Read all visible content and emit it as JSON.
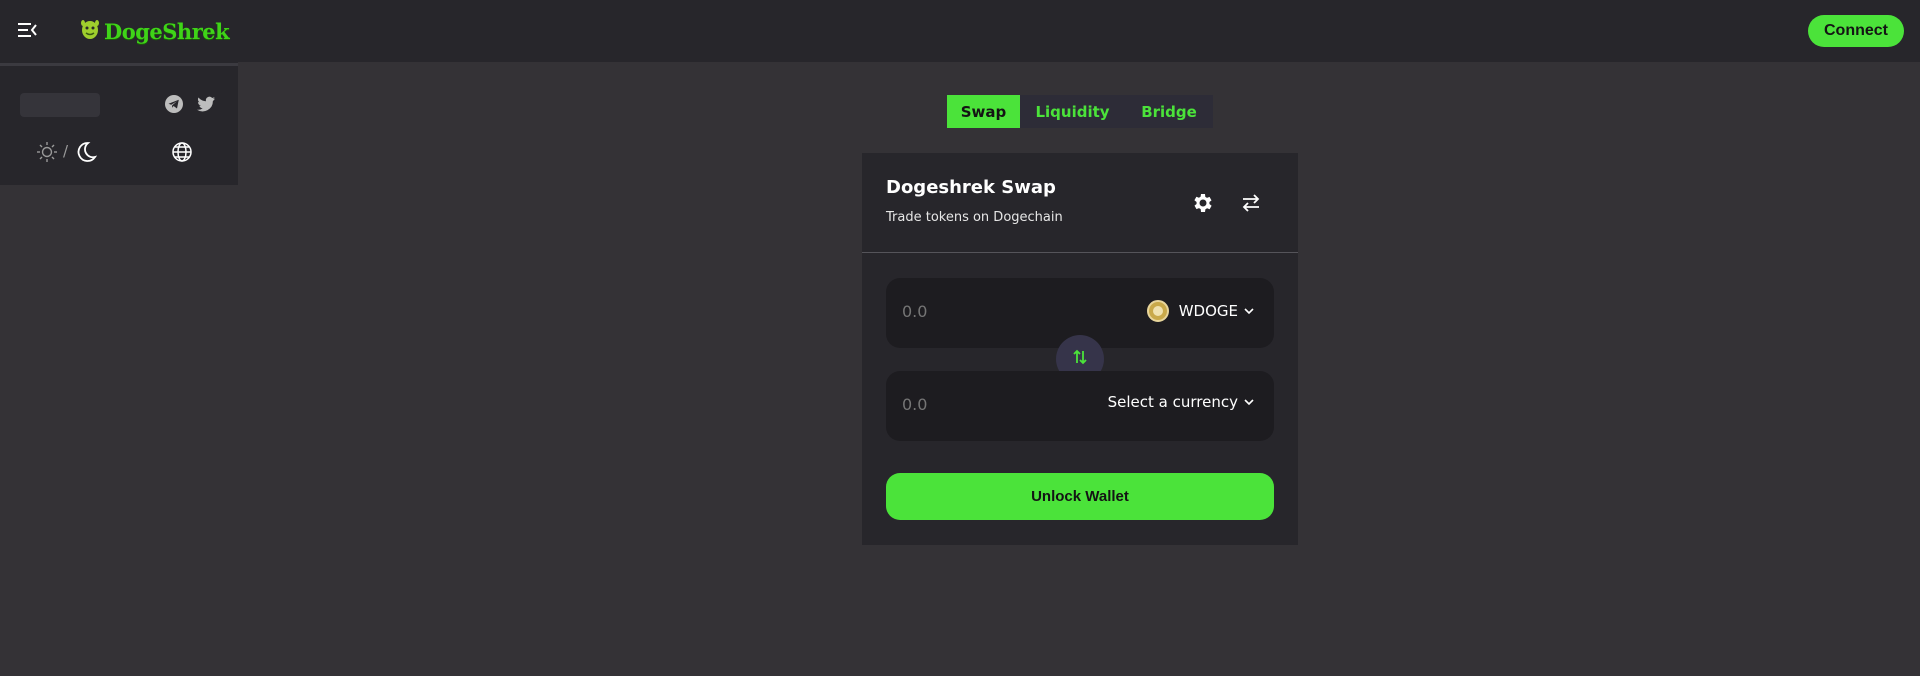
{
  "header": {
    "logo_text": "DogeShrek",
    "connect_label": "Connect"
  },
  "sidebar": {
    "theme_separator": "/"
  },
  "tabs": [
    {
      "label": "Swap",
      "active": true
    },
    {
      "label": "Liquidity",
      "active": false
    },
    {
      "label": "Bridge",
      "active": false
    }
  ],
  "swap": {
    "title": "Dogeshrek Swap",
    "subtitle": "Trade tokens on Dogechain",
    "from": {
      "amount": "0.0",
      "token": "WDOGE"
    },
    "to": {
      "amount": "0.0",
      "token": "Select a currency"
    },
    "unlock_label": "Unlock Wallet"
  },
  "icons": {
    "menu": "menu-collapse-icon",
    "logo": "shrek-logo-icon",
    "telegram": "telegram-icon",
    "twitter": "twitter-icon",
    "sun": "sun-icon",
    "moon": "moon-icon",
    "language": "globe-icon",
    "settings": "gear-icon",
    "history": "transfer-arrows-icon",
    "switch": "swap-direction-icon",
    "token": "wdoge-coin-icon",
    "chevron": "chevron-down-icon"
  },
  "colors": {
    "accent": "#4be33a",
    "page_bg": "#343236",
    "panel_bg": "#27262b",
    "input_bg": "#1d1c20"
  }
}
